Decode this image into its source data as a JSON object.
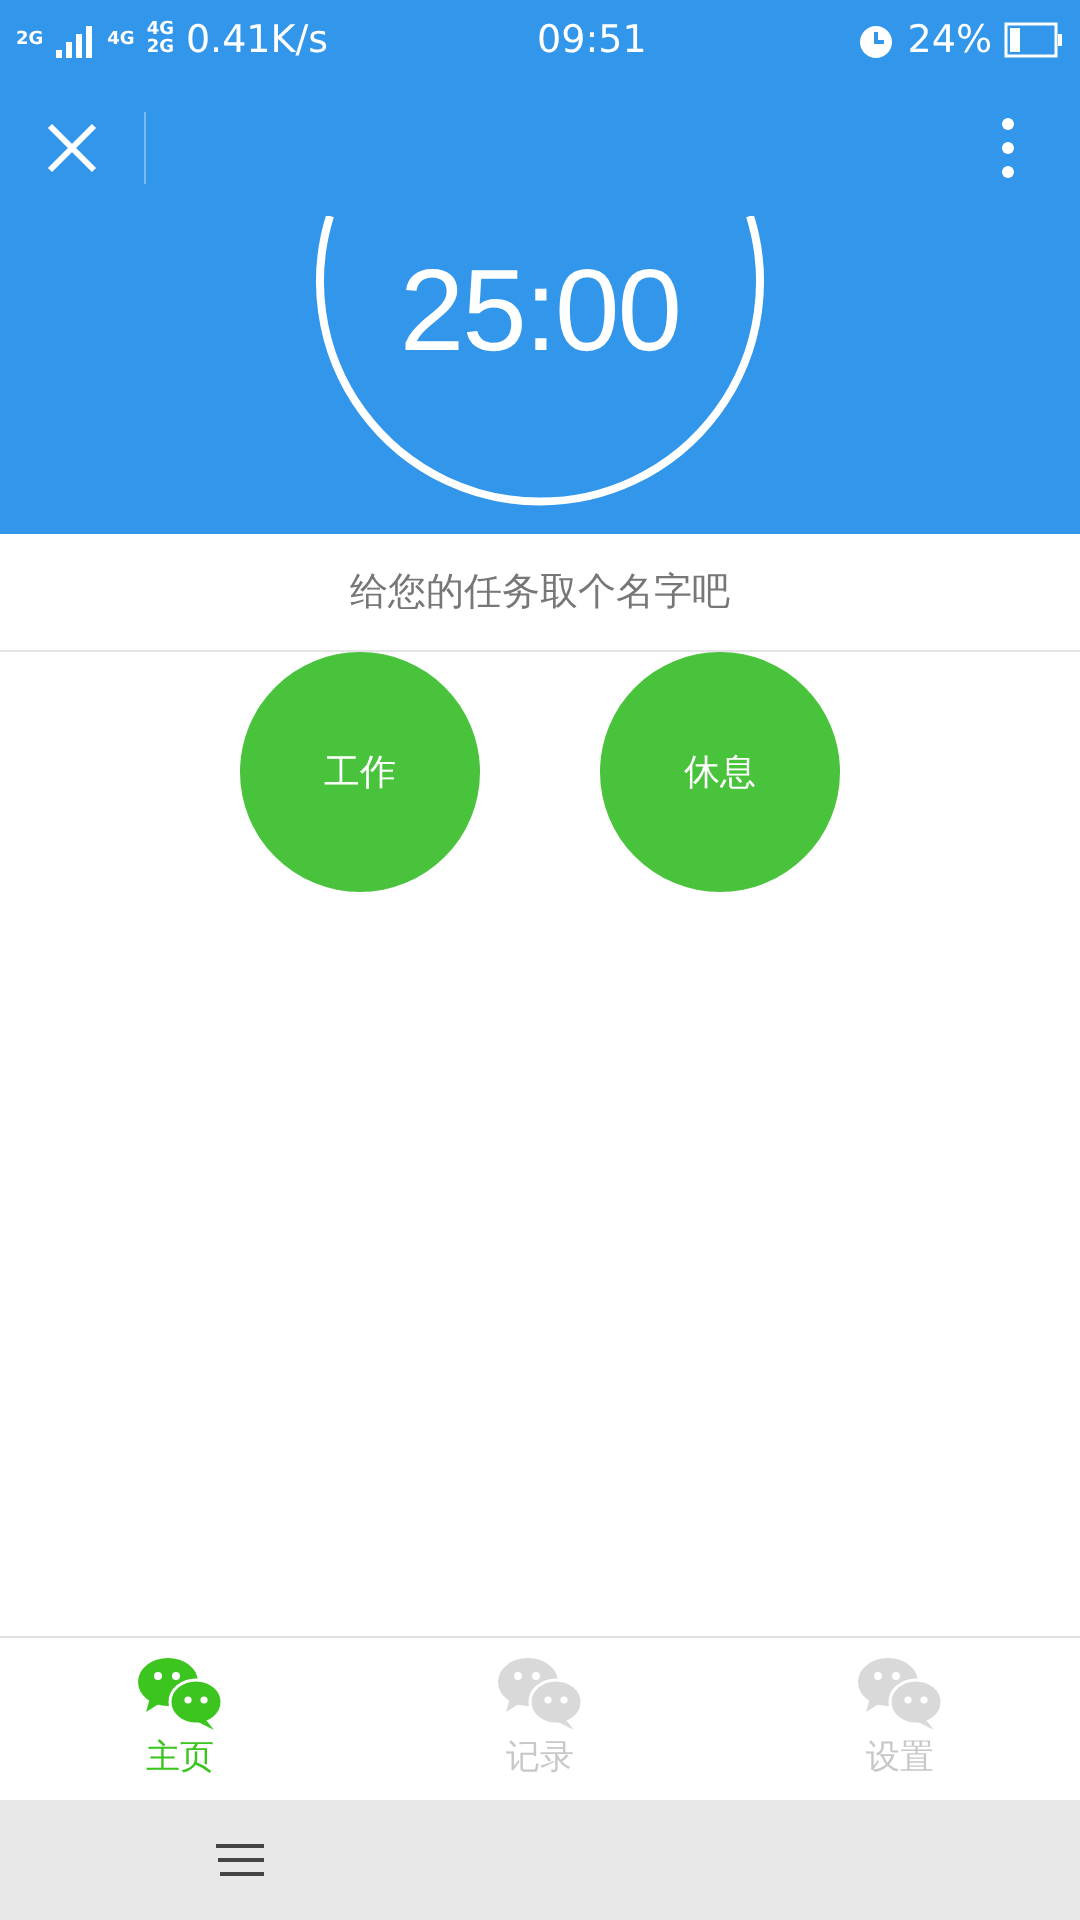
{
  "status_bar": {
    "sim1": "2G",
    "sim2_top": "4G",
    "sim2_bottom": "4G",
    "sim3": "2G",
    "speed": "0.41K/s",
    "time": "09:51",
    "battery": "24%"
  },
  "timer": {
    "display": "25:00"
  },
  "task_name": {
    "placeholder": "给您的任务取个名字吧"
  },
  "mode_buttons": [
    "工作",
    "休息"
  ],
  "tabs": [
    {
      "label": "主页",
      "selected": true
    },
    {
      "label": "记录",
      "selected": false
    },
    {
      "label": "设置",
      "selected": false
    }
  ]
}
